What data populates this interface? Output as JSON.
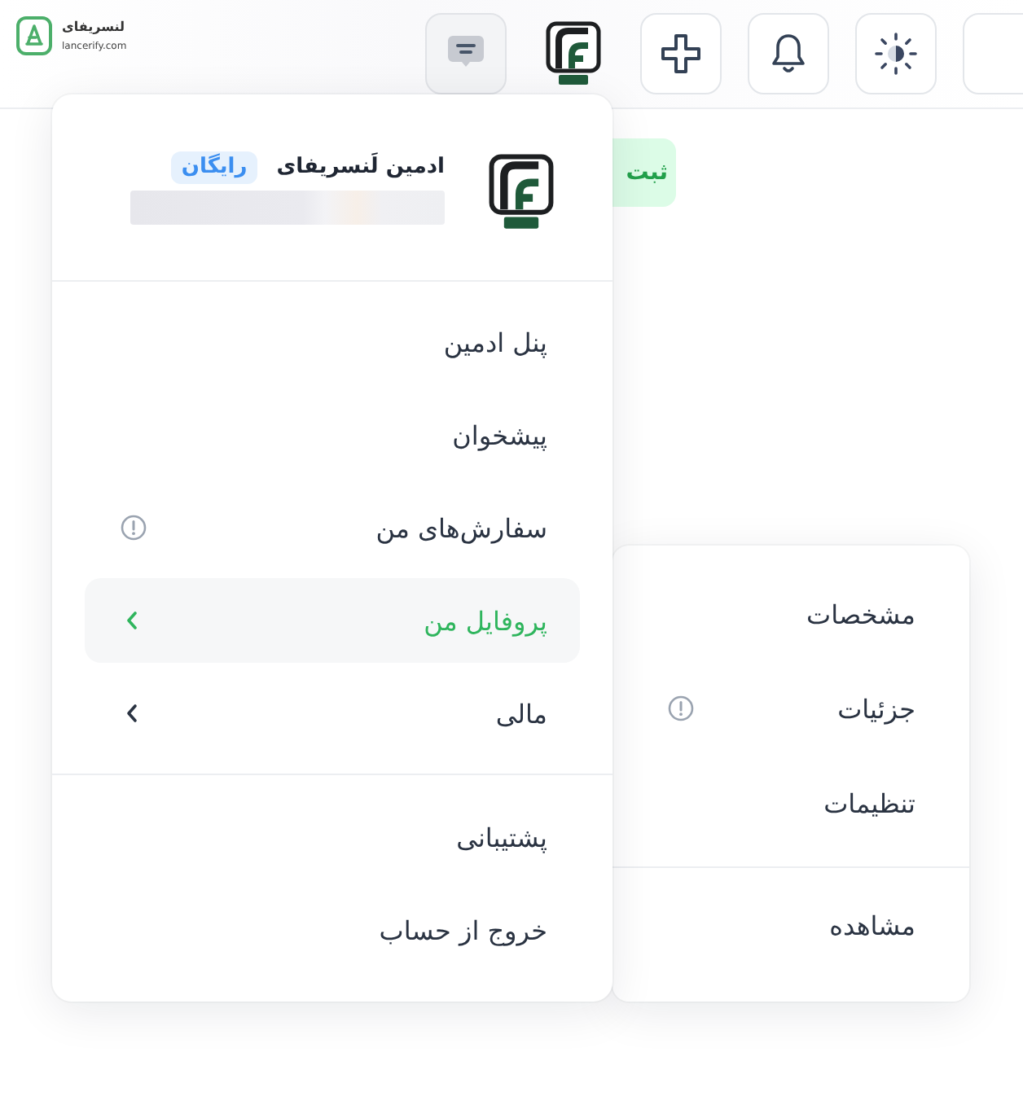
{
  "top_bar": {
    "logo": {
      "name": "لنسریفای",
      "domain": "lancerify.com"
    },
    "buttons": [
      {
        "kind": "chat",
        "selected": true
      },
      {
        "kind": "avatar",
        "selected": false
      },
      {
        "kind": "add",
        "selected": false
      },
      {
        "kind": "bell",
        "selected": false
      },
      {
        "kind": "theme",
        "selected": false
      },
      {
        "kind": "blank",
        "selected": false
      }
    ]
  },
  "page": {
    "action_button": {
      "label": "ثبت"
    }
  },
  "account_menu": {
    "user": {
      "name": "ادمین لَنسریفای",
      "plan_badge": "رایگان"
    },
    "groups": [
      {
        "items": [
          {
            "label": "پنل ادمین",
            "selected": false,
            "alert": false,
            "submenu": false
          },
          {
            "label": "پیشخوان",
            "selected": false,
            "alert": false,
            "submenu": false
          },
          {
            "label": "سفارش‌های من",
            "selected": false,
            "alert": true,
            "submenu": false
          },
          {
            "label": "پروفایل من",
            "selected": true,
            "alert": false,
            "submenu": true
          },
          {
            "label": "مالی",
            "selected": false,
            "alert": false,
            "submenu": true
          }
        ]
      },
      {
        "items": [
          {
            "label": "پشتیبانی",
            "selected": false,
            "alert": false,
            "submenu": false
          },
          {
            "label": "خروج از حساب",
            "selected": false,
            "alert": false,
            "submenu": false
          }
        ]
      }
    ]
  },
  "submenu": {
    "groups": [
      {
        "items": [
          {
            "label": "مشخصات",
            "selected": false,
            "alert": false
          },
          {
            "label": "جزئیات",
            "selected": false,
            "alert": true
          },
          {
            "label": "تنظیمات",
            "selected": false,
            "alert": false
          }
        ]
      },
      {
        "items": [
          {
            "label": "مشاهده",
            "selected": false,
            "alert": false
          }
        ]
      }
    ]
  }
}
